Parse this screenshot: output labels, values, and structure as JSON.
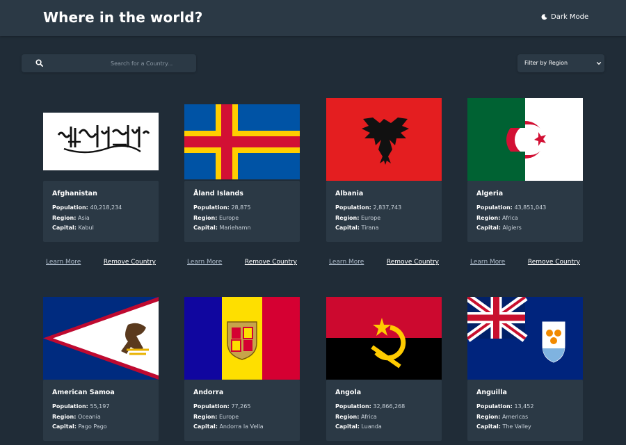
{
  "header": {
    "title": "Where in the world?",
    "mode_label": "Dark Mode"
  },
  "search": {
    "placeholder": "Search for a Country..."
  },
  "filter": {
    "label": "Filter by Region"
  },
  "labels": {
    "population": "Population:",
    "region": "Region:",
    "capital": "Capital:",
    "learn_more": "Learn More",
    "remove": "Remove Country"
  },
  "countries": [
    {
      "name": "Afghanistan",
      "population": "40,218,234",
      "region": "Asia",
      "capital": "Kabul"
    },
    {
      "name": "Åland Islands",
      "population": "28,875",
      "region": "Europe",
      "capital": "Mariehamn"
    },
    {
      "name": "Albania",
      "population": "2,837,743",
      "region": "Europe",
      "capital": "Tirana"
    },
    {
      "name": "Algeria",
      "population": "43,851,043",
      "region": "Africa",
      "capital": "Algiers"
    },
    {
      "name": "American Samoa",
      "population": "55,197",
      "region": "Oceania",
      "capital": "Pago Pago"
    },
    {
      "name": "Andorra",
      "population": "77,265",
      "region": "Europe",
      "capital": "Andorra la Vella"
    },
    {
      "name": "Angola",
      "population": "32,866,268",
      "region": "Africa",
      "capital": "Luanda"
    },
    {
      "name": "Anguilla",
      "population": "13,452",
      "region": "Americas",
      "capital": "The Valley"
    }
  ],
  "colors": {
    "background": "#202c37",
    "surface": "#2b3945",
    "text": "#ffffff",
    "link": "#aebccb"
  }
}
